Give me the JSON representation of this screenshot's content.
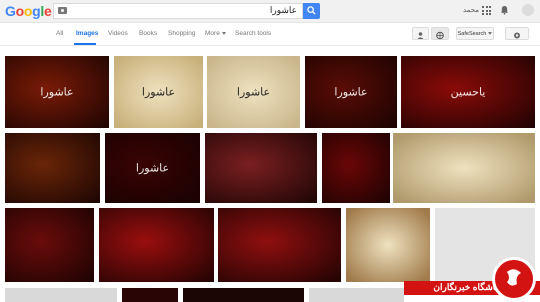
{
  "header": {
    "logo_letters": [
      "G",
      "o",
      "o",
      "g",
      "l",
      "e"
    ],
    "logo_colors": [
      "#4285f4",
      "#ea4335",
      "#fbbc05",
      "#4285f4",
      "#34a853",
      "#ea4335"
    ],
    "search_query": "عاشورا",
    "user_name": "محمد",
    "accent_color": "#4285f4"
  },
  "tabs": {
    "items": [
      "All",
      "Images",
      "Videos",
      "Books",
      "Shopping",
      "More",
      "Search tools"
    ],
    "active": "Images",
    "safesearch_label": "SafeSearch"
  },
  "thumbnails": [
    {
      "title": "عاشورا",
      "bg": "#7a1b06"
    },
    {
      "title": "عاشورا",
      "bg": "#c8b07a"
    },
    {
      "title": "عاشورا",
      "bg": "#c9b68c"
    },
    {
      "title": "عاشورا",
      "bg": "#5a0c04"
    },
    {
      "title": "یاحسین",
      "bg": "#8a0b08"
    },
    {
      "title": "",
      "bg": "#6a2508"
    },
    {
      "title": "عاشورا",
      "bg": "#3a0303"
    },
    {
      "title": "",
      "bg": "#7a1f20"
    },
    {
      "title": "",
      "bg": "#6a0606"
    },
    {
      "title": "",
      "bg": "#b09a6c"
    },
    {
      "title": "",
      "bg": "#6a0c0a"
    },
    {
      "title": "",
      "bg": "#9a0e0e"
    },
    {
      "title": "",
      "bg": "#900f0f"
    },
    {
      "title": "",
      "bg": "#a07a4a"
    },
    {
      "title": "",
      "bg": "#d8d8d8"
    }
  ],
  "watermark": {
    "text": "باشگاه خبرنگاران",
    "color": "#d31212"
  }
}
